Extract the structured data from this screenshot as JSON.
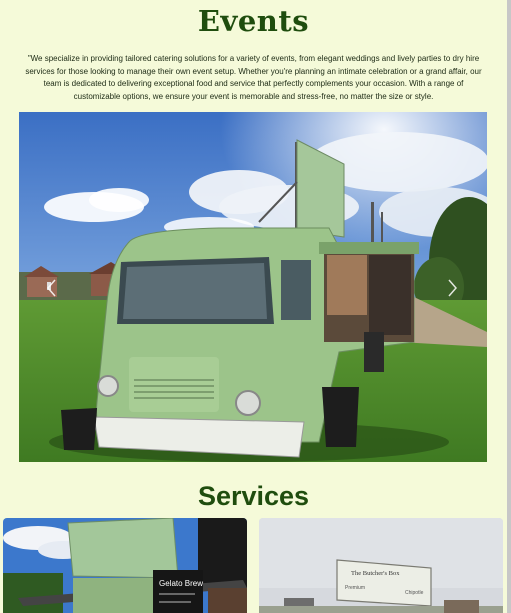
{
  "page": {
    "title": "Events",
    "intro": "\"We specialize in providing tailored catering solutions for a variety of events, from elegant weddings and lively parties to dry hire services for those looking to manage their own event setup. Whether you're planning an intimate celebration or a grand affair, our team is dedicated to delivering exceptional food and service that perfectly complements your occasion. With a range of customizable options, we ensure your event is memorable and stress-free, no matter the size or style.",
    "services_title": "Services"
  },
  "carousel": {
    "next_icon": "chevron-right-icon",
    "prev_icon": "chevron-left-icon"
  },
  "cards": [
    {
      "chalkboard_text": "Gelato Brew"
    },
    {
      "sign_title": "The Butcher's Box",
      "sign_left": "Premium",
      "sign_right": "Chipotle"
    }
  ],
  "colors": {
    "background": "#f5fad9",
    "heading": "#1f4d0e",
    "van_green": "#9cc48a"
  }
}
